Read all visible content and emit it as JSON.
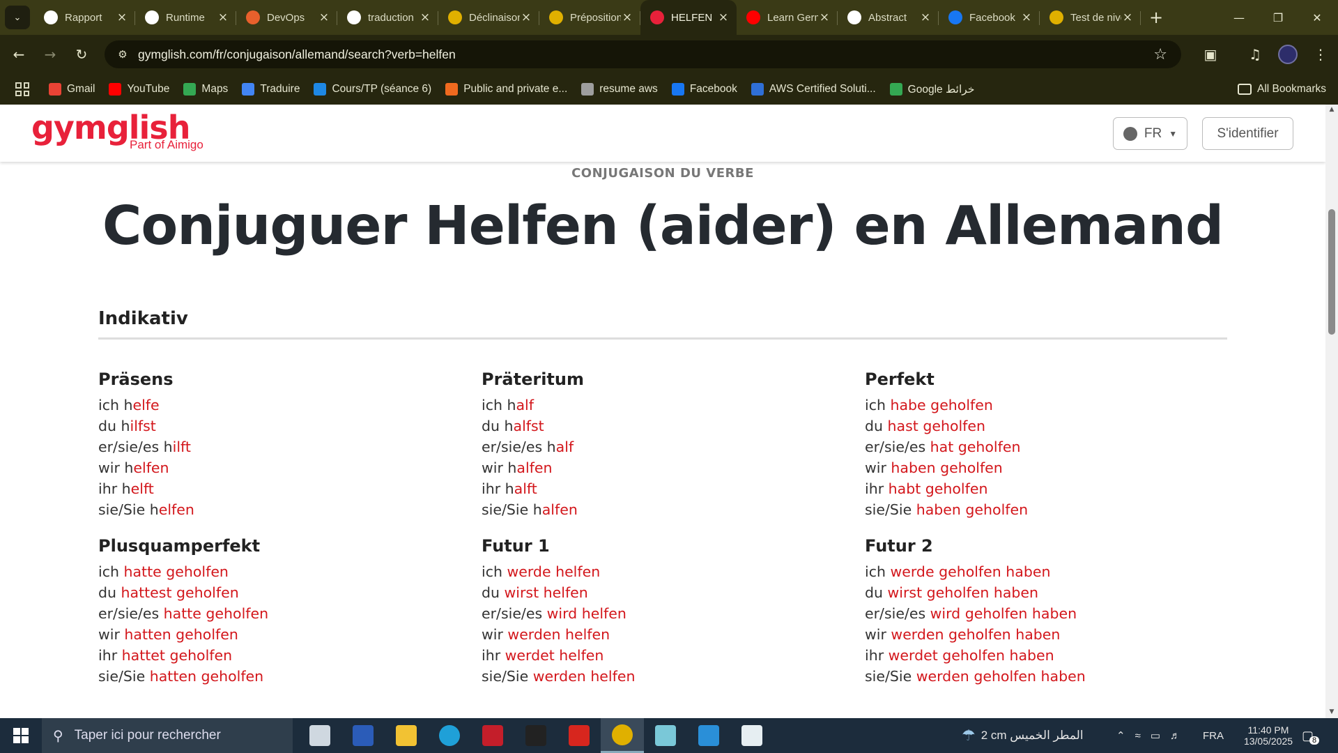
{
  "browser": {
    "tabs": [
      {
        "title": "Rapport",
        "icon": "openai-icon",
        "color": "#ffffff"
      },
      {
        "title": "Runtime",
        "icon": "openai-icon",
        "color": "#ffffff"
      },
      {
        "title": "DevOps",
        "icon": "devops-icon",
        "color": "#e8602c"
      },
      {
        "title": "traduction",
        "icon": "google-icon",
        "color": "#ffffff"
      },
      {
        "title": "Déclinaison",
        "icon": "colorblock-icon",
        "color": "#e0b000"
      },
      {
        "title": "Préposition",
        "icon": "colorblock-icon",
        "color": "#e0b000"
      },
      {
        "title": "HELFEN",
        "icon": "gymglish-icon",
        "color": "#e8213a",
        "active": true
      },
      {
        "title": "Learn German",
        "icon": "youtube-icon",
        "color": "#ff0000"
      },
      {
        "title": "Abstract",
        "icon": "openai-icon",
        "color": "#ffffff"
      },
      {
        "title": "Facebook",
        "icon": "facebook-icon",
        "color": "#1877f2"
      },
      {
        "title": "Test de niveau",
        "icon": "colorblock-icon",
        "color": "#e0b000"
      }
    ],
    "url": "gymglish.com/fr/conjugaison/allemand/search?verb=helfen",
    "bookmarks": [
      {
        "label": "Gmail",
        "icon": "gmail-icon",
        "color": "#ea4335"
      },
      {
        "label": "YouTube",
        "icon": "youtube-icon",
        "color": "#ff0000"
      },
      {
        "label": "Maps",
        "icon": "maps-icon",
        "color": "#34a853"
      },
      {
        "label": "Traduire",
        "icon": "translate-icon",
        "color": "#4285f4"
      },
      {
        "label": "Cours/TP (séance 6)",
        "icon": "classroom-icon",
        "color": "#1e88e5"
      },
      {
        "label": "Public and private e...",
        "icon": "pdf-icon",
        "color": "#f06a1f"
      },
      {
        "label": "resume aws",
        "icon": "globe-icon",
        "color": "#9e9e9e"
      },
      {
        "label": "Facebook",
        "icon": "facebook-icon",
        "color": "#1877f2"
      },
      {
        "label": "AWS Certified Soluti...",
        "icon": "list-icon",
        "color": "#2f6fd6"
      },
      {
        "label": "Google خرائط",
        "icon": "maps-icon",
        "color": "#34a853"
      }
    ],
    "all_bookmarks": "All Bookmarks"
  },
  "site": {
    "logo": "gymglish",
    "logo_sub": "Part of Aimigo",
    "lang": "FR",
    "login": "S'identifier"
  },
  "content": {
    "kicker": "CONJUGAISON DU VERBE",
    "title": "Conjuguer Helfen (aider) en Allemand",
    "section": "Indikativ",
    "tenses": [
      {
        "name": "Präsens",
        "rows": [
          {
            "pronoun": "ich h",
            "ending": "elfe"
          },
          {
            "pronoun": "du h",
            "ending": "ilfst"
          },
          {
            "pronoun": "er/sie/es h",
            "ending": "ilft"
          },
          {
            "pronoun": "wir h",
            "ending": "elfen"
          },
          {
            "pronoun": "ihr h",
            "ending": "elft"
          },
          {
            "pronoun": "sie/Sie h",
            "ending": "elfen"
          }
        ]
      },
      {
        "name": "Präteritum",
        "rows": [
          {
            "pronoun": "ich h",
            "ending": "alf"
          },
          {
            "pronoun": "du h",
            "ending": "alfst"
          },
          {
            "pronoun": "er/sie/es h",
            "ending": "alf"
          },
          {
            "pronoun": "wir h",
            "ending": "alfen"
          },
          {
            "pronoun": "ihr h",
            "ending": "alft"
          },
          {
            "pronoun": "sie/Sie h",
            "ending": "alfen"
          }
        ]
      },
      {
        "name": "Perfekt",
        "rows": [
          {
            "pronoun": "ich ",
            "ending": "habe geholfen"
          },
          {
            "pronoun": "du ",
            "ending": "hast geholfen"
          },
          {
            "pronoun": "er/sie/es ",
            "ending": "hat geholfen"
          },
          {
            "pronoun": "wir ",
            "ending": "haben geholfen"
          },
          {
            "pronoun": "ihr ",
            "ending": "habt geholfen"
          },
          {
            "pronoun": "sie/Sie ",
            "ending": "haben geholfen"
          }
        ]
      },
      {
        "name": "Plusquamperfekt",
        "rows": [
          {
            "pronoun": "ich ",
            "ending": "hatte geholfen"
          },
          {
            "pronoun": "du ",
            "ending": "hattest geholfen"
          },
          {
            "pronoun": "er/sie/es ",
            "ending": "hatte geholfen"
          },
          {
            "pronoun": "wir ",
            "ending": "hatten geholfen"
          },
          {
            "pronoun": "ihr ",
            "ending": "hattet geholfen"
          },
          {
            "pronoun": "sie/Sie ",
            "ending": "hatten geholfen"
          }
        ]
      },
      {
        "name": "Futur 1",
        "rows": [
          {
            "pronoun": "ich ",
            "ending": "werde helfen"
          },
          {
            "pronoun": "du ",
            "ending": "wirst helfen"
          },
          {
            "pronoun": "er/sie/es ",
            "ending": "wird helfen"
          },
          {
            "pronoun": "wir ",
            "ending": "werden helfen"
          },
          {
            "pronoun": "ihr ",
            "ending": "werdet helfen"
          },
          {
            "pronoun": "sie/Sie ",
            "ending": "werden helfen"
          }
        ]
      },
      {
        "name": "Futur 2",
        "rows": [
          {
            "pronoun": "ich ",
            "ending": "werde geholfen haben"
          },
          {
            "pronoun": "du ",
            "ending": "wirst geholfen haben"
          },
          {
            "pronoun": "er/sie/es ",
            "ending": "wird geholfen haben"
          },
          {
            "pronoun": "wir ",
            "ending": "werden geholfen haben"
          },
          {
            "pronoun": "ihr ",
            "ending": "werdet geholfen haben"
          },
          {
            "pronoun": "sie/Sie ",
            "ending": "werden geholfen haben"
          }
        ]
      }
    ]
  },
  "taskbar": {
    "search_placeholder": "Taper ici pour rechercher",
    "apps": [
      {
        "name": "task-view-icon",
        "color": "#cfd8e0"
      },
      {
        "name": "word-icon",
        "color": "#2b5cb8"
      },
      {
        "name": "file-explorer-icon",
        "color": "#f2c233"
      },
      {
        "name": "edge-icon",
        "color": "#1fa0d8"
      },
      {
        "name": "app-red-icon",
        "color": "#c41e2a"
      },
      {
        "name": "terminal-icon",
        "color": "#222222"
      },
      {
        "name": "acrobat-icon",
        "color": "#d7261e"
      },
      {
        "name": "chrome-icon",
        "color": "#e0b000",
        "active": true
      },
      {
        "name": "notepad-icon",
        "color": "#7ac8d8"
      },
      {
        "name": "photos-icon",
        "color": "#2a8fd8"
      },
      {
        "name": "paint-icon",
        "color": "#e6eef2"
      }
    ],
    "weather": "2 cm المطر الخميس",
    "language": "FRA",
    "time": "11:40 PM",
    "date": "13/05/2025",
    "notifications": "8"
  }
}
